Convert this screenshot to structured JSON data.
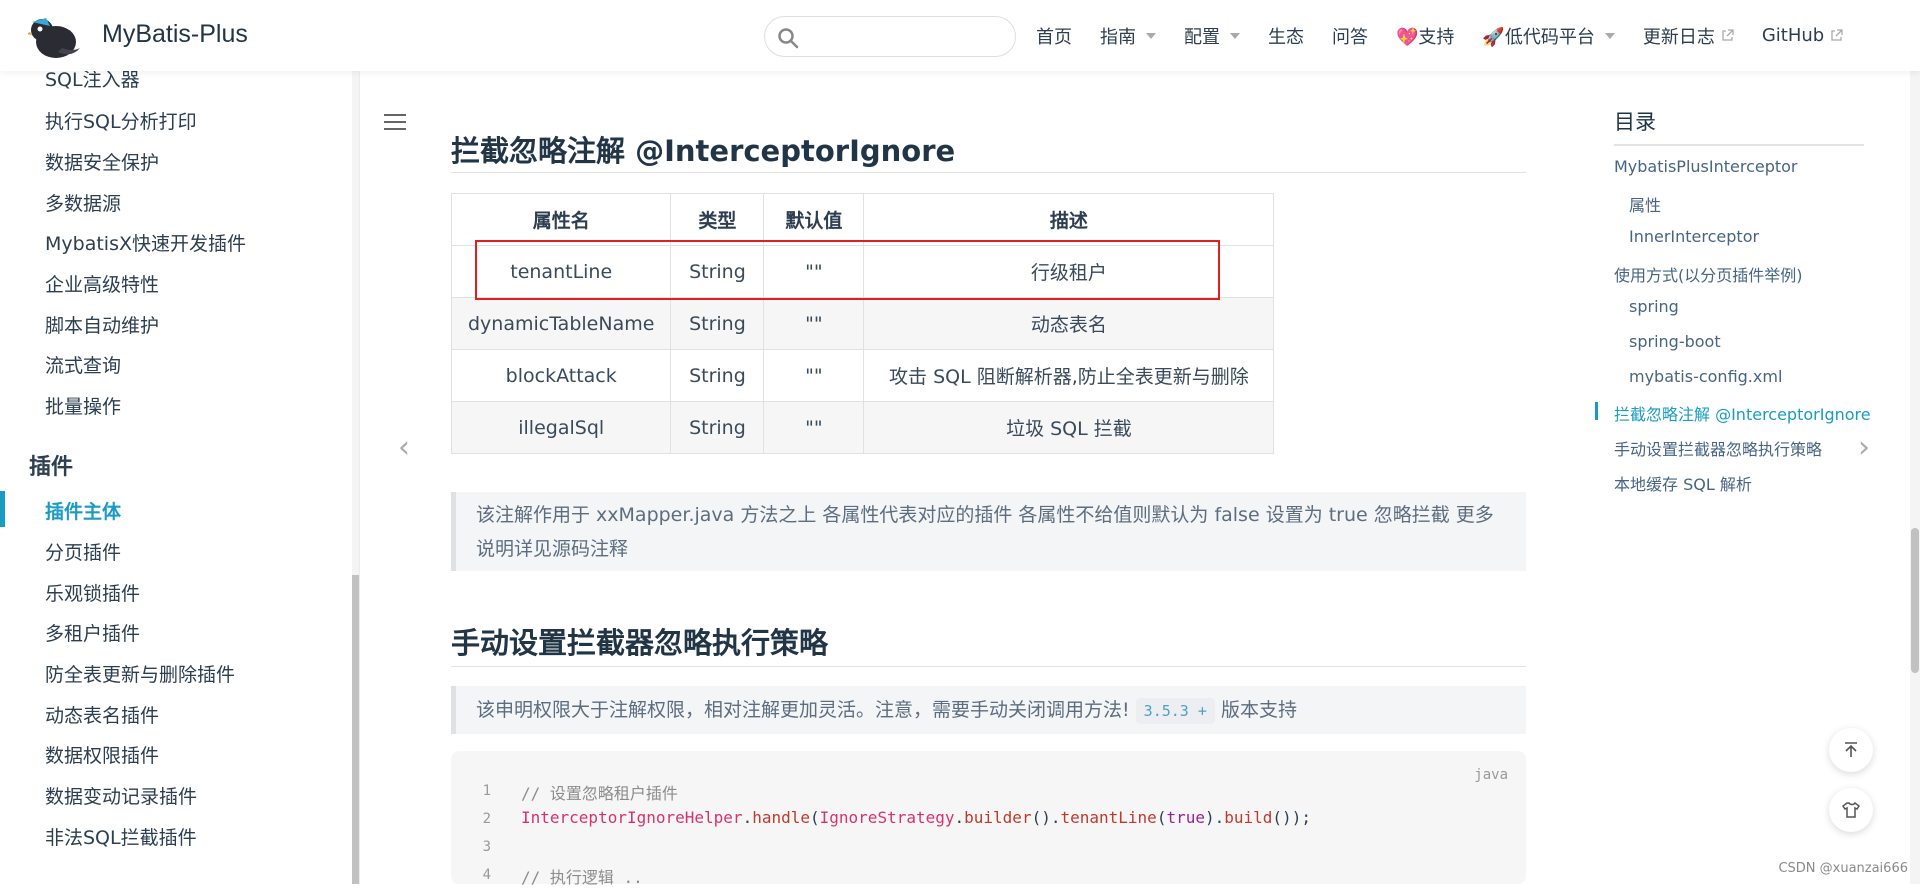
{
  "header": {
    "title": "MyBatis-Plus",
    "search_placeholder": "",
    "nav": [
      {
        "label": "首页"
      },
      {
        "label": "指南"
      },
      {
        "label": "配置"
      },
      {
        "label": "生态"
      },
      {
        "label": "问答"
      },
      {
        "label": "💖支持"
      },
      {
        "label": "🚀低代码平台"
      },
      {
        "label": "更新日志"
      },
      {
        "label": "GitHub"
      }
    ]
  },
  "sidebar": {
    "items_top": [
      "SQL注入器",
      "执行SQL分析打印",
      "数据安全保护",
      "多数据源",
      "MybatisX快速开发插件",
      "企业高级特性",
      "脚本自动维护",
      "流式查询",
      "批量操作"
    ],
    "group_label": "插件",
    "items_plugins": [
      "插件主体",
      "分页插件",
      "乐观锁插件",
      "多租户插件",
      "防全表更新与删除插件",
      "动态表名插件",
      "数据权限插件",
      "数据变动记录插件",
      "非法SQL拦截插件"
    ],
    "active_item": "插件主体"
  },
  "main": {
    "section1_title": "拦截忽略注解 @InterceptorIgnore",
    "table": {
      "headers": [
        "属性名",
        "类型",
        "默认值",
        "描述"
      ],
      "rows": [
        [
          "tenantLine",
          "String",
          "\"\"",
          "行级租户"
        ],
        [
          "dynamicTableName",
          "String",
          "\"\"",
          "动态表名"
        ],
        [
          "blockAttack",
          "String",
          "\"\"",
          "攻击 SQL 阻断解析器,防止全表更新与删除"
        ],
        [
          "illegalSql",
          "String",
          "\"\"",
          "垃圾 SQL 拦截"
        ]
      ]
    },
    "tip1_line1": "该注解作用于 xxMapper.java 方法之上 各属性代表对应的插件 各属性不给值则默认为 false 设置为 true 忽略拦截 更多",
    "tip1_line2": "说明详见源码注释",
    "section2_title": "手动设置拦截器忽略执行策略",
    "tip2_text": "该申明权限大于注解权限，相对注解更加灵活。注意，需要手动关闭调用方法!",
    "tip2_badge": "3.5.3 +",
    "tip2_suffix": "版本支持",
    "code": {
      "lang": "java",
      "line_numbers": [
        "1",
        "2",
        "3",
        "4"
      ],
      "line1": "// 设置忽略租户插件",
      "line2_a": "InterceptorIgnoreHelper",
      "line2_b": ".",
      "line2_c": "handle",
      "line2_d": "(",
      "line2_e": "IgnoreStrategy",
      "line2_f": ".",
      "line2_g": "builder",
      "line2_h": "().",
      "line2_i": "tenantLine",
      "line2_j": "(",
      "line2_k": "true",
      "line2_l": ").",
      "line2_m": "build",
      "line2_n": "());",
      "line4": "// 执行逻辑 .."
    }
  },
  "toc": {
    "title": "目录",
    "items": [
      {
        "label": "MybatisPlusInterceptor",
        "level": 1
      },
      {
        "label": "属性",
        "level": 2
      },
      {
        "label": "InnerInterceptor",
        "level": 2
      },
      {
        "label": "使用方式(以分页插件举例)",
        "level": 1
      },
      {
        "label": "spring",
        "level": 2
      },
      {
        "label": "spring-boot",
        "level": 2
      },
      {
        "label": "mybatis-config.xml",
        "level": 2
      },
      {
        "label": "拦截忽略注解 @InterceptorIgnore",
        "level": 1,
        "active": true
      },
      {
        "label": "手动设置拦截器忽略执行策略",
        "level": 1
      },
      {
        "label": "本地缓存 SQL 解析",
        "level": 1
      }
    ]
  },
  "watermark": "CSDN @xuanzai666",
  "colors": {
    "accent": "#1a9bc2",
    "highlight_box": "#e02020"
  }
}
